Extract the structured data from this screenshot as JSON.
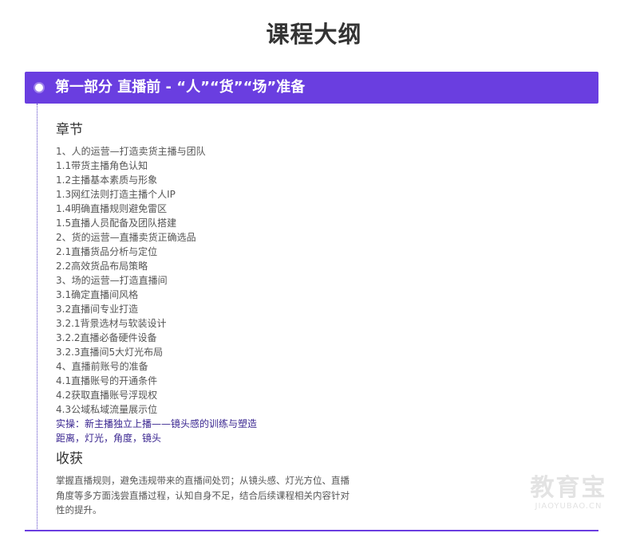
{
  "page_title": "课程大纲",
  "banner": {
    "title": "第一部分 直播前 - “人”“货”“场”准备"
  },
  "chapters": {
    "heading": "章节",
    "items": [
      {
        "text": "1、人的运营—打造卖货主播与团队",
        "highlight": false
      },
      {
        "text": "1.1带货主播角色认知",
        "highlight": false
      },
      {
        "text": "1.2主播基本素质与形象",
        "highlight": false
      },
      {
        "text": "1.3网红法则打造主播个人IP",
        "highlight": false
      },
      {
        "text": "1.4明确直播规则避免雷区",
        "highlight": false
      },
      {
        "text": "1.5直播人员配备及团队搭建",
        "highlight": false
      },
      {
        "text": "2、货的运营—直播卖货正确选品",
        "highlight": false
      },
      {
        "text": "2.1直播货品分析与定位",
        "highlight": false
      },
      {
        "text": "2.2高效货品布局策略",
        "highlight": false
      },
      {
        "text": "3、场的运营—打造直播间",
        "highlight": false
      },
      {
        "text": "3.1确定直播间风格",
        "highlight": false
      },
      {
        "text": "3.2直播间专业打造",
        "highlight": false
      },
      {
        "text": "3.2.1背景选材与软装设计",
        "highlight": false
      },
      {
        "text": "3.2.2直播必备硬件设备",
        "highlight": false
      },
      {
        "text": "3.2.3直播间5大灯光布局",
        "highlight": false
      },
      {
        "text": "4、直播前账号的准备",
        "highlight": false
      },
      {
        "text": "4.1直播账号的开通条件",
        "highlight": false
      },
      {
        "text": "4.2获取直播账号浮现权",
        "highlight": false
      },
      {
        "text": "4.3公域私域流量展示位",
        "highlight": false
      },
      {
        "text": "实操：新主播独立上播——镜头感的训练与塑造",
        "highlight": true
      },
      {
        "text": "距离，灯光，角度，镜头",
        "highlight": true
      }
    ]
  },
  "gains": {
    "heading": "收获",
    "text": "掌握直播规则，避免违规带来的直播间处罚；从镜头感、灯光方位、直播角度等多方面浅尝直播过程，认知自身不足，结合后续课程相关内容针对性的提升。"
  },
  "watermark": {
    "main": "教育宝",
    "sub": "JIAOYUBAO.CN"
  },
  "colors": {
    "accent": "#6a3ee0",
    "highlight_text": "#3a2690",
    "body_text": "#555555"
  }
}
